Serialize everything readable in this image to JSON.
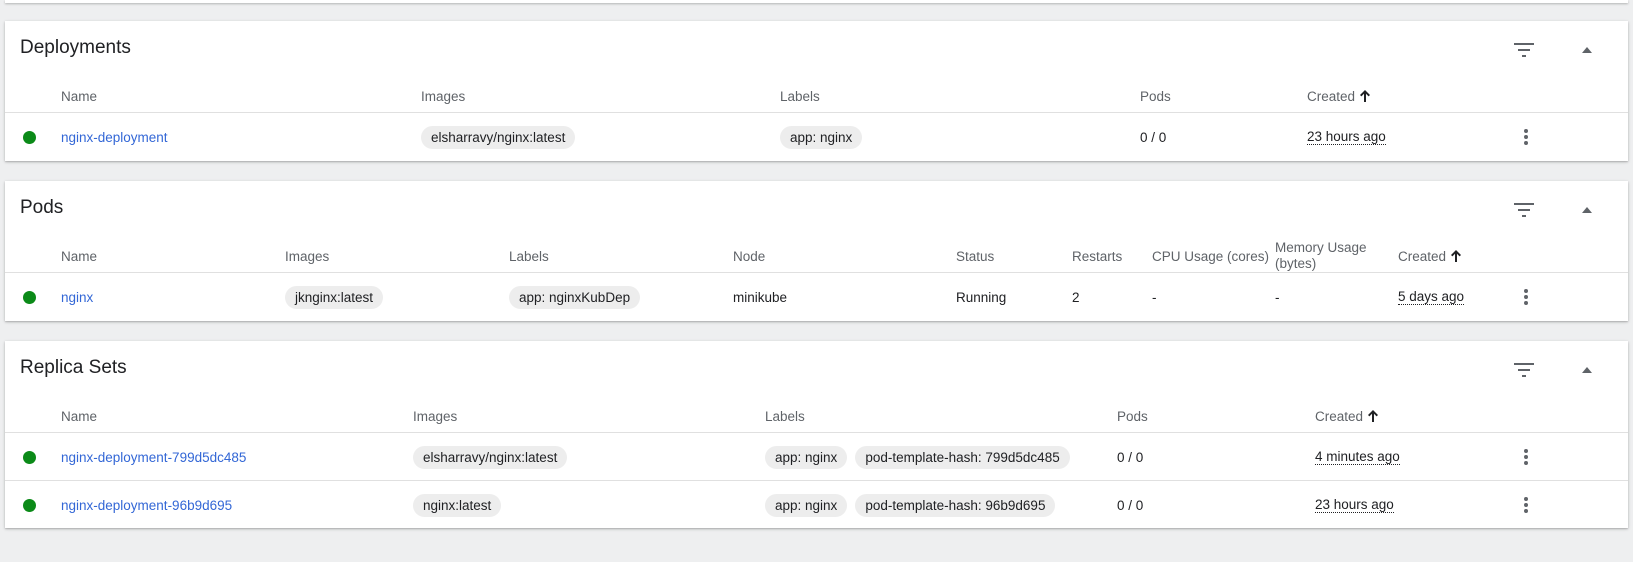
{
  "deployments": {
    "title": "Deployments",
    "columns": {
      "name": "Name",
      "images": "Images",
      "labels": "Labels",
      "pods": "Pods",
      "created": "Created"
    },
    "rows": [
      {
        "name": "nginx-deployment",
        "image": "elsharravy/nginx:latest",
        "labels": [
          "app: nginx"
        ],
        "pods": "0 / 0",
        "created": "23 hours ago"
      }
    ]
  },
  "pods": {
    "title": "Pods",
    "columns": {
      "name": "Name",
      "images": "Images",
      "labels": "Labels",
      "node": "Node",
      "status": "Status",
      "restarts": "Restarts",
      "cpu": "CPU Usage (cores)",
      "memory_line1": "Memory Usage",
      "memory_line2": "(bytes)",
      "created": "Created"
    },
    "rows": [
      {
        "name": "nginx",
        "image": "jknginx:latest",
        "labels": [
          "app: nginxKubDep"
        ],
        "node": "minikube",
        "status": "Running",
        "restarts": "2",
        "cpu": "-",
        "memory": "-",
        "created": "5 days ago"
      }
    ]
  },
  "replica_sets": {
    "title": "Replica Sets",
    "columns": {
      "name": "Name",
      "images": "Images",
      "labels": "Labels",
      "pods": "Pods",
      "created": "Created"
    },
    "rows": [
      {
        "name": "nginx-deployment-799d5dc485",
        "image": "elsharravy/nginx:latest",
        "labels": [
          "app: nginx",
          "pod-template-hash: 799d5dc485"
        ],
        "pods": "0 / 0",
        "created": "4 minutes ago"
      },
      {
        "name": "nginx-deployment-96b9d695",
        "image": "nginx:latest",
        "labels": [
          "app: nginx",
          "pod-template-hash: 96b9d695"
        ],
        "pods": "0 / 0",
        "created": "23 hours ago"
      }
    ]
  },
  "icons": {
    "filter": "filter-icon",
    "collapse": "chevron-up-icon",
    "sort": "arrow-upward-icon",
    "row_menu": "more-vert-icon",
    "status": "status-ok-icon"
  },
  "colors": {
    "status_ok": "#0b8a18",
    "link": "#3367d6",
    "background": "#eeeff0",
    "chip": "#ededed"
  }
}
